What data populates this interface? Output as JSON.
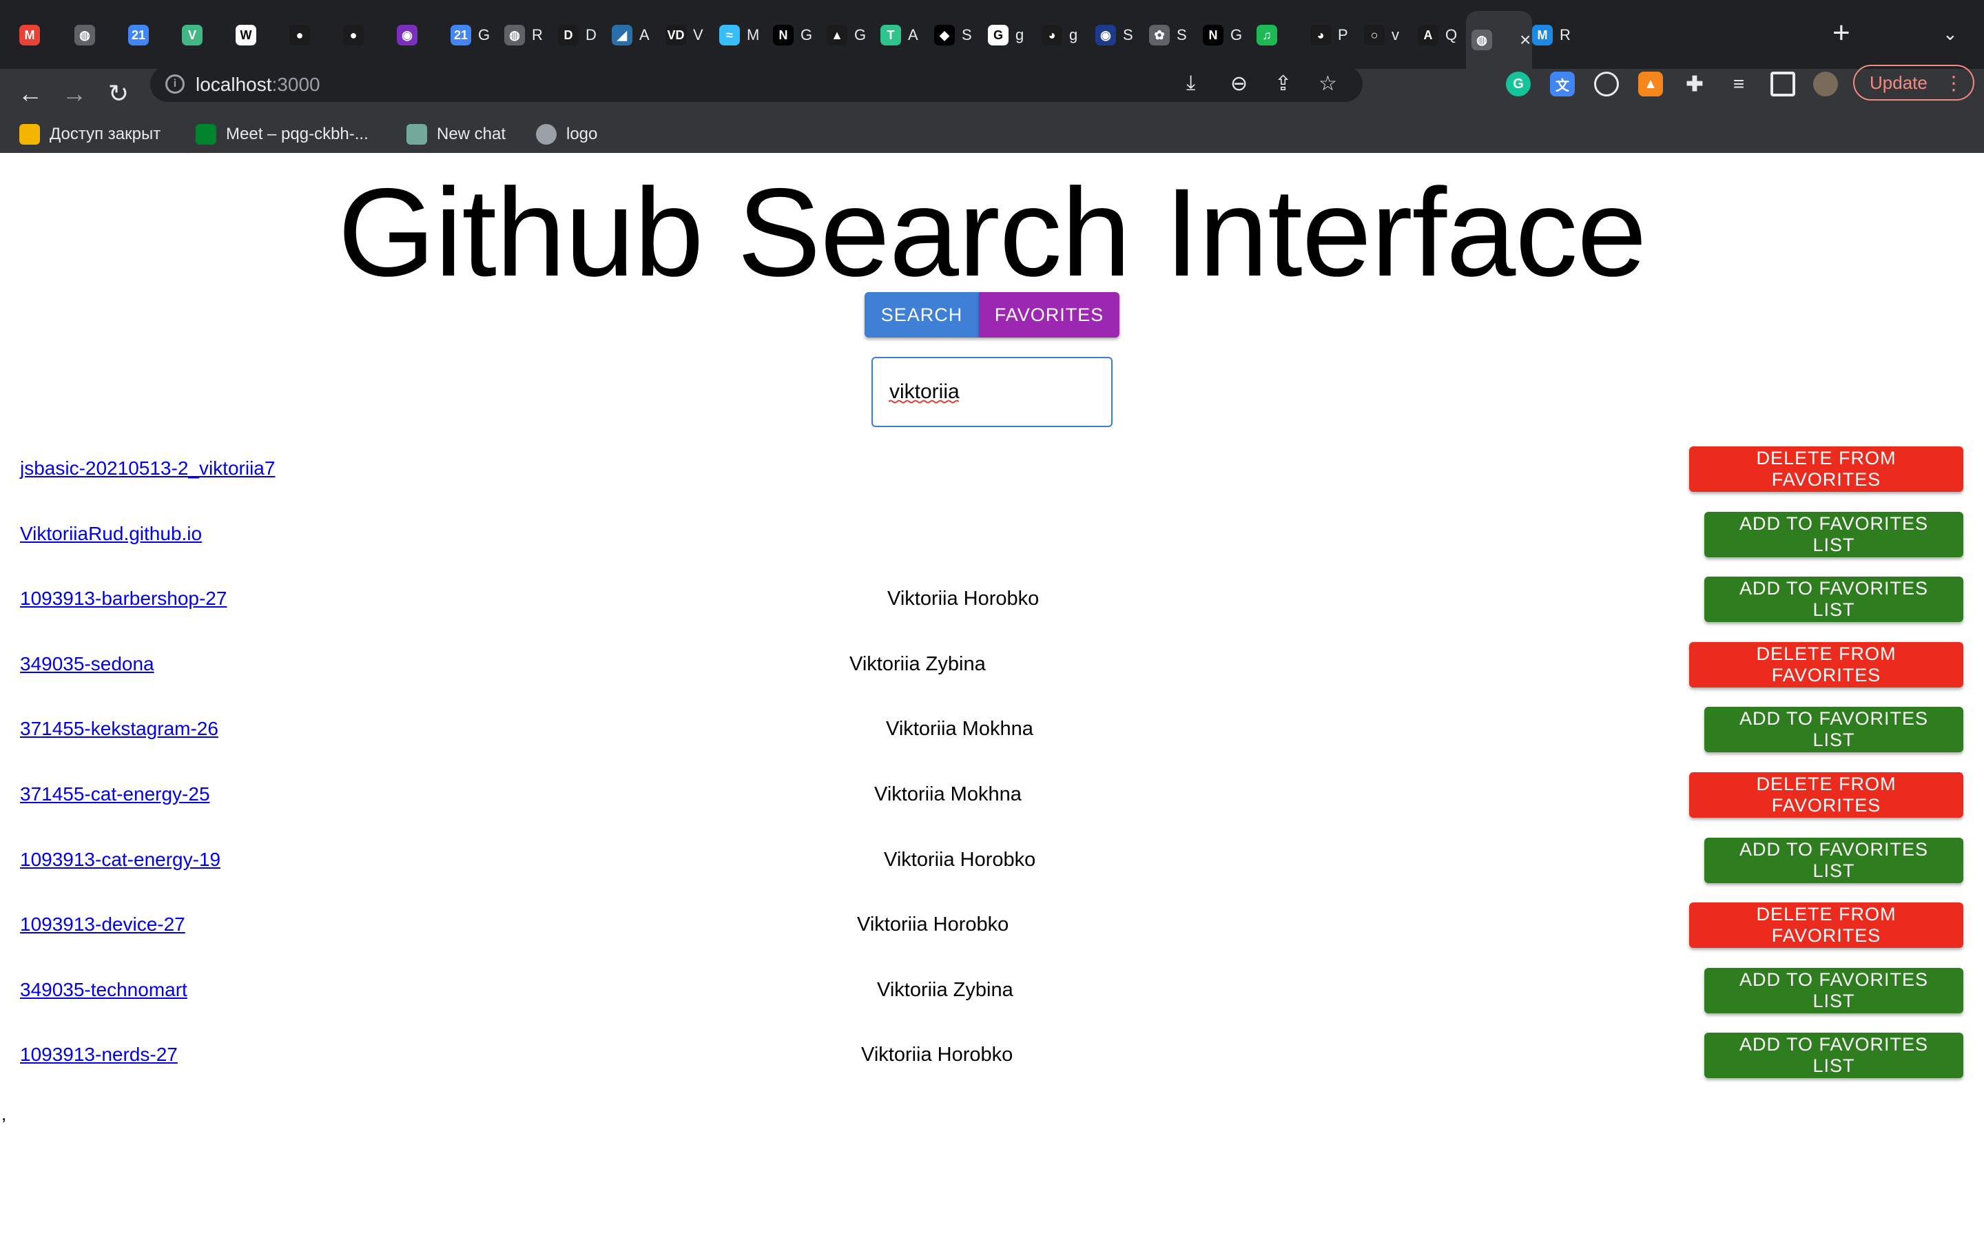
{
  "browser": {
    "tabs": [
      {
        "letter": "M",
        "color": "#ea4335",
        "title": ""
      },
      {
        "letter": "◍",
        "color": "#5f6368",
        "title": ""
      },
      {
        "letter": "21",
        "color": "#4285f4",
        "title": ""
      },
      {
        "letter": "V",
        "color": "#41b883",
        "title": ""
      },
      {
        "letter": "W",
        "color": "#ffffff",
        "title": ""
      },
      {
        "letter": "●",
        "color": "#1b1b1b",
        "title": ""
      },
      {
        "letter": "●",
        "color": "#1b1b1b",
        "title": ""
      },
      {
        "letter": "◉",
        "color": "#7b2fbe",
        "title": ""
      },
      {
        "letter": "21",
        "color": "#4285f4",
        "title": "G"
      },
      {
        "letter": "◍",
        "color": "#5f6368",
        "title": "R"
      },
      {
        "letter": "D",
        "color": "#1b1b1b",
        "title": "D"
      },
      {
        "letter": "◢",
        "color": "#2b6fa8",
        "title": "A"
      },
      {
        "letter": "VD",
        "color": "#1b1b1b",
        "title": "V"
      },
      {
        "letter": "≈",
        "color": "#38bdf8",
        "title": "M"
      },
      {
        "letter": "N",
        "color": "#000000",
        "title": "G"
      },
      {
        "letter": "▲",
        "color": "#1b1b1b",
        "title": "G"
      },
      {
        "letter": "T",
        "color": "#30c48d",
        "title": "A"
      },
      {
        "letter": "◆",
        "color": "#000000",
        "title": "S"
      },
      {
        "letter": "G",
        "color": "#ffffff",
        "title": "g"
      },
      {
        "letter": "◕",
        "color": "#1b1b1b",
        "title": "g"
      },
      {
        "letter": "◉",
        "color": "#1e3a8a",
        "title": "S"
      },
      {
        "letter": "✿",
        "color": "#5f6368",
        "title": "S"
      },
      {
        "letter": "N",
        "color": "#000000",
        "title": "G"
      },
      {
        "letter": "♫",
        "color": "#1db954",
        "title": ""
      },
      {
        "letter": "◕",
        "color": "#1b1b1b",
        "title": "P"
      },
      {
        "letter": "○",
        "color": "#1b1b1b",
        "title": "v"
      },
      {
        "letter": "A",
        "color": "#1b1b1b",
        "title": "Q"
      },
      {
        "letter": "◍",
        "color": "#5f6368",
        "title": ""
      },
      {
        "letter": "M",
        "color": "#1e88e5",
        "title": "R"
      }
    ],
    "url_host": "localhost",
    "url_port": ":3000",
    "update_label": "Update",
    "bookmarks": [
      {
        "label": "Доступ закрыт",
        "color": "#f4b400"
      },
      {
        "label": "Meet – pqg-ckbh-...",
        "color": "#00832d"
      },
      {
        "label": "New chat",
        "color": "#74aa9c"
      },
      {
        "label": "logo",
        "color": "#9aa0a6"
      }
    ]
  },
  "page": {
    "title": "Github Search Interface",
    "search_tab_label": "SEARCH",
    "favorites_tab_label": "FAVORITES",
    "search_value": "viktoriia",
    "stray_text": ","
  },
  "results": [
    {
      "repo": "jsbasic-20210513-2_viktoriia7",
      "owner": "",
      "action": "DELETE FROM FAVORITES",
      "type": "del"
    },
    {
      "repo": "ViktoriiaRud.github.io",
      "owner": "",
      "action": "ADD TO FAVORITES LIST",
      "type": "add"
    },
    {
      "repo": "1093913-barbershop-27",
      "owner": "Viktoriia Horobko",
      "action": "ADD TO FAVORITES LIST",
      "type": "add"
    },
    {
      "repo": "349035-sedona",
      "owner": "Viktoriia Zybina",
      "action": "DELETE FROM FAVORITES",
      "type": "del"
    },
    {
      "repo": "371455-kekstagram-26",
      "owner": "Viktoriia Mokhna",
      "action": "ADD TO FAVORITES LIST",
      "type": "add"
    },
    {
      "repo": "371455-cat-energy-25",
      "owner": "Viktoriia Mokhna",
      "action": "DELETE FROM FAVORITES",
      "type": "del"
    },
    {
      "repo": "1093913-cat-energy-19",
      "owner": "Viktoriia Horobko",
      "action": "ADD TO FAVORITES LIST",
      "type": "add"
    },
    {
      "repo": "1093913-device-27",
      "owner": "Viktoriia Horobko",
      "action": "DELETE FROM FAVORITES",
      "type": "del"
    },
    {
      "repo": "349035-technomart",
      "owner": "Viktoriia Zybina",
      "action": "ADD TO FAVORITES LIST",
      "type": "add"
    },
    {
      "repo": "1093913-nerds-27",
      "owner": "Viktoriia Horobko",
      "action": "ADD TO FAVORITES LIST",
      "type": "add"
    }
  ]
}
